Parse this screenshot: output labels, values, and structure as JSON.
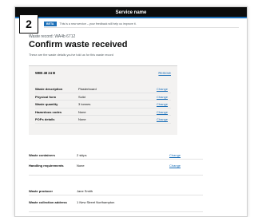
{
  "step": "2",
  "header": {
    "service_name": "Service name"
  },
  "phase": {
    "tag": "Beta",
    "text": "This is a new service – your feedback will help us improve it."
  },
  "back_link": "Back",
  "caption": "Waste record: WA4b 6712",
  "page_title": "Confirm waste received",
  "lede": "These are the waste details you've told us for this waste record",
  "card": {
    "id_label": "WB5 48 24 B",
    "remove_label": "Remove",
    "rows": [
      {
        "key": "Waste description",
        "value": "Plasterboard",
        "change": "Change"
      },
      {
        "key": "Physical form",
        "value": "Solid",
        "change": "Change"
      },
      {
        "key": "Waste quantity",
        "value": "3 tonnes",
        "change": "Change"
      },
      {
        "key": "Hazardous codes",
        "value": "None",
        "change": "Change"
      },
      {
        "key": "POPs details",
        "value": "None",
        "change": "Change"
      }
    ]
  },
  "summary": [
    {
      "key": "Waste containers",
      "value": "2 skips",
      "change": "Change"
    },
    {
      "key": "Handling requirements",
      "value": "None",
      "change": "Change"
    },
    {
      "key": "Waste producer",
      "value": "Jane Smith",
      "change": ""
    },
    {
      "key": "Waste collection address",
      "value": "1 New Street Northampton",
      "change": ""
    }
  ],
  "colors": {
    "header": "#0b0c0c",
    "link": "#1d70b8",
    "card": "#f3f2f1"
  }
}
